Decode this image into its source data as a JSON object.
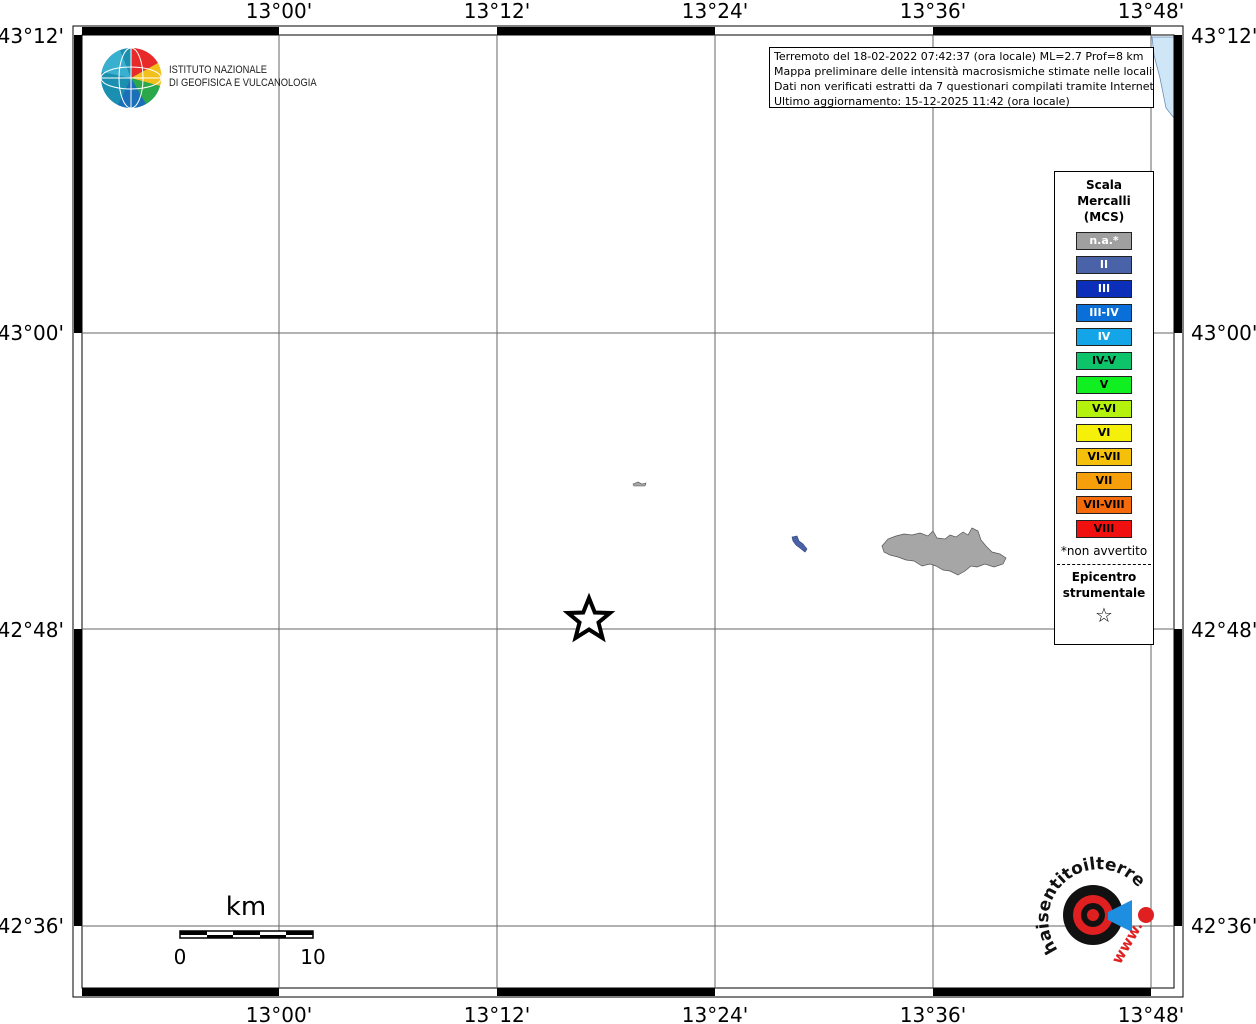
{
  "lon_ticks": [
    "13°00'",
    "13°12'",
    "13°24'",
    "13°36'",
    "13°48'"
  ],
  "lat_ticks": [
    "43°12'",
    "43°00'",
    "42°48'",
    "42°36'"
  ],
  "logo": {
    "line1": "ISTITUTO NAZIONALE",
    "line2": "DI GEOFISICA E VULCANOLOGIA"
  },
  "info": {
    "line1": "Terremoto del 18-02-2022 07:42:37 (ora locale) ML=2.7 Prof=8 km",
    "line2": "Mappa preliminare delle intensità macrosismiche stimate nelle località",
    "line3": "Dati non verificati estratti da 7 questionari compilati tramite Internet.",
    "line4": "Ultimo aggiornamento: 15-12-2025 11:42 (ora locale)"
  },
  "legend": {
    "title_line1": "Scala",
    "title_line2": "Mercalli",
    "title_line3": "(MCS)",
    "items": [
      {
        "label": "n.a.*",
        "color": "#a0a0a0",
        "text": "#ffffff"
      },
      {
        "label": "II",
        "color": "#4a63a8",
        "text": "#ffffff"
      },
      {
        "label": "III",
        "color": "#0b2fb8",
        "text": "#ffffff"
      },
      {
        "label": "III-IV",
        "color": "#0a6fd8",
        "text": "#ffffff"
      },
      {
        "label": "IV",
        "color": "#13a5e8",
        "text": "#ffffff"
      },
      {
        "label": "IV-V",
        "color": "#0ec46a",
        "text": "#000000"
      },
      {
        "label": "V",
        "color": "#10f020",
        "text": "#000000"
      },
      {
        "label": "V-VI",
        "color": "#b4f20e",
        "text": "#000000"
      },
      {
        "label": "VI",
        "color": "#f5f00a",
        "text": "#000000"
      },
      {
        "label": "VI-VII",
        "color": "#f5c00a",
        "text": "#000000"
      },
      {
        "label": "VII",
        "color": "#f5a00a",
        "text": "#000000"
      },
      {
        "label": "VII-VIII",
        "color": "#f56a0a",
        "text": "#000000"
      },
      {
        "label": "VIII",
        "color": "#f01010",
        "text": "#000000"
      }
    ],
    "note": "*non avvertito",
    "epicenter_line1": "Epicentro",
    "epicenter_line2": "strumentale",
    "star_symbol": "☆"
  },
  "scale_bar": {
    "unit": "km",
    "label_start": "0",
    "label_end": "10"
  },
  "hsit_logo": {
    "curve_text": "haisentitoilterremoto.it",
    "bottom_text": "www."
  },
  "colors": {
    "area_gray": "#a6a6a6",
    "lake_blue": "#4a63a8",
    "sea_blue": "#cfe6f7"
  }
}
